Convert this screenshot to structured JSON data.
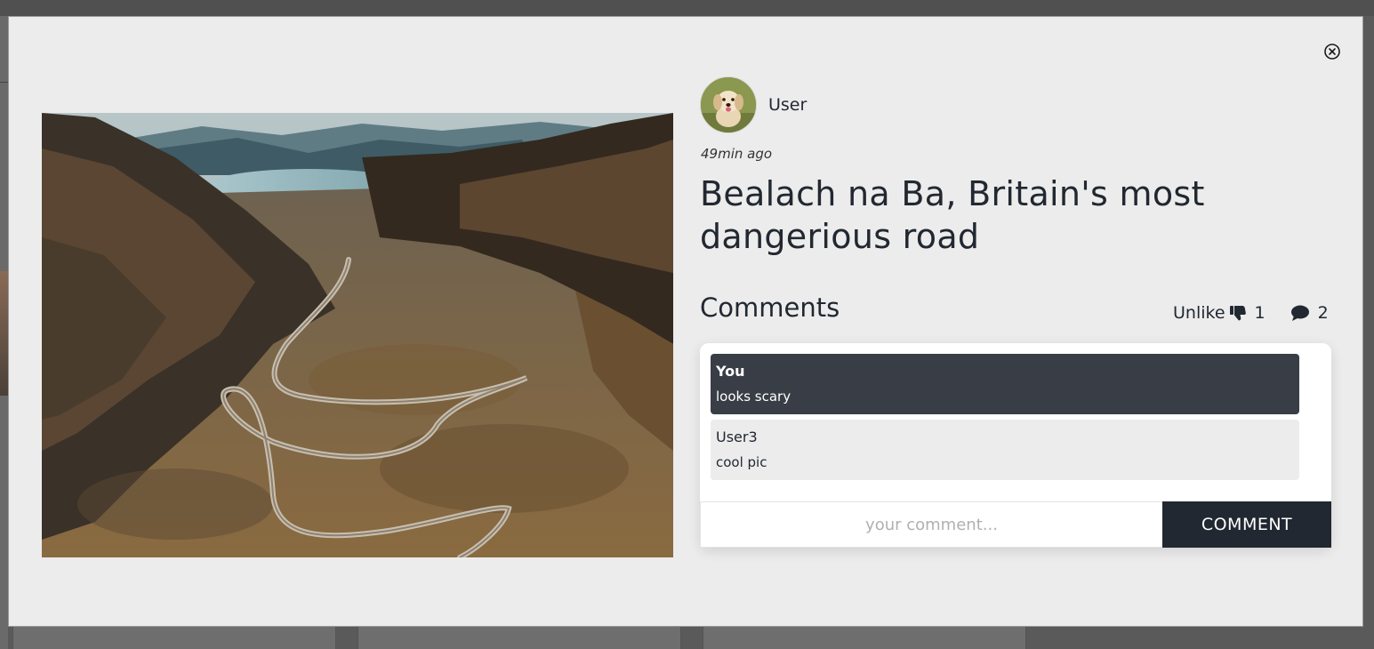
{
  "post": {
    "author_name": "User",
    "timestamp": "49min ago",
    "title": "Bealach na Ba, Britain's most dangerious road",
    "photo": "mountain-valley-winding-road-photo"
  },
  "comments_section": {
    "heading": "Comments",
    "unlike_label": "Unlike",
    "like_count": "1",
    "comment_count": "2",
    "comments": [
      {
        "author": "You",
        "text": "looks scary"
      },
      {
        "author": "User3",
        "text": "cool pic"
      }
    ],
    "input_placeholder": "your comment...",
    "submit_label": "COMMENT"
  },
  "icons": {
    "close": "close-circle-icon",
    "unlike": "thumbs-down-icon",
    "comments": "comment-bubble-icon"
  },
  "colors": {
    "modal_bg": "#ececec",
    "dark": "#222831",
    "own_comment_bg": "#393e46",
    "other_comment_bg": "#ececec"
  }
}
